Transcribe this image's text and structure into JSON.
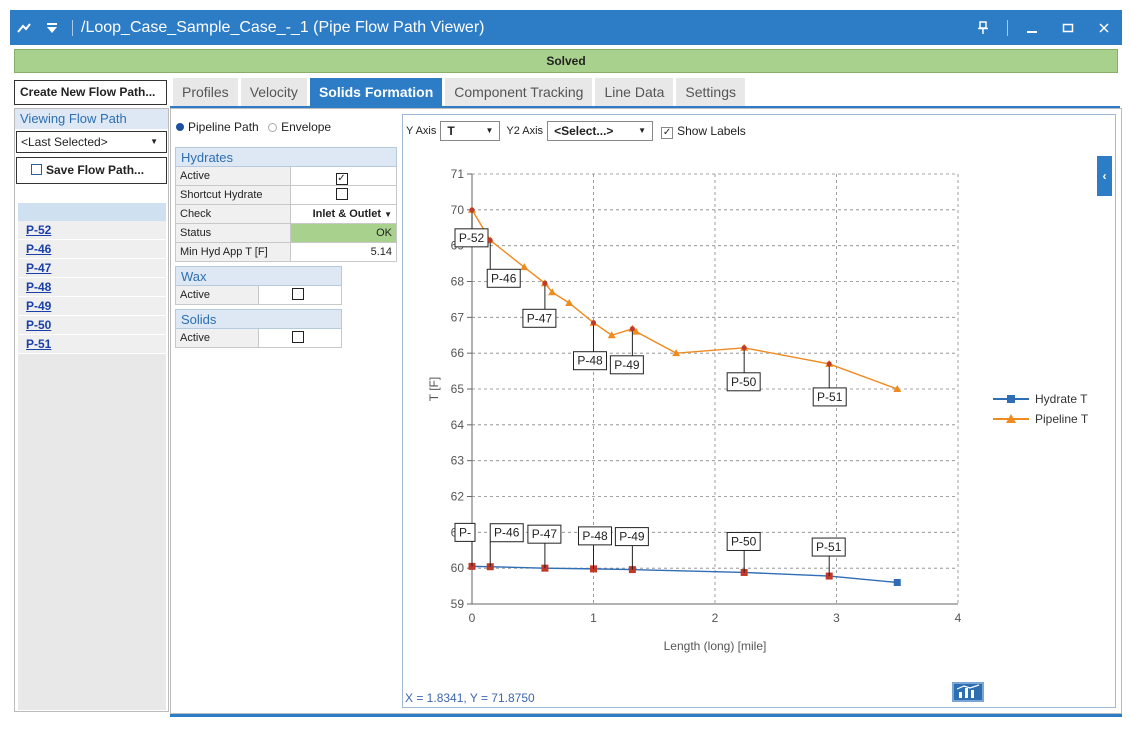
{
  "window": {
    "title": "/Loop_Case_Sample_Case_-_1 (Pipe Flow Path Viewer)",
    "status": "Solved"
  },
  "colors": {
    "accent": "#2d7cc6",
    "status_green": "#a9d18e",
    "hydrate_series": "#2f6db5",
    "pipeline_series": "#ef8a1f",
    "label_marker": "#c0392b"
  },
  "left": {
    "create_label": "Create New Flow Path...",
    "viewing_title": "Viewing Flow Path",
    "selector_value": "<Last Selected>",
    "save_label": "Save Flow Path...",
    "flow_paths": [
      "P-52",
      "P-46",
      "P-47",
      "P-48",
      "P-49",
      "P-50",
      "P-51"
    ]
  },
  "tabs": [
    "Profiles",
    "Velocity",
    "Solids Formation",
    "Component Tracking",
    "Line Data",
    "Settings"
  ],
  "active_tab": "Solids Formation",
  "mode": {
    "pipeline_label": "Pipeline Path",
    "envelope_label": "Envelope",
    "selected": "Pipeline Path"
  },
  "hydrates": {
    "title": "Hydrates",
    "rows": [
      {
        "label": "Active",
        "value": "checked"
      },
      {
        "label": "Shortcut Hydrate",
        "value": "unchecked"
      },
      {
        "label": "Check",
        "value": "Inlet & Outlet"
      },
      {
        "label": "Status",
        "value": "OK"
      },
      {
        "label": "Min Hyd App T [F]",
        "value": "5.14"
      }
    ]
  },
  "wax": {
    "title": "Wax",
    "active_label": "Active",
    "active": false
  },
  "solids": {
    "title": "Solids",
    "active_label": "Active",
    "active": false
  },
  "chart_controls": {
    "y_axis_label": "Y Axis",
    "y_axis_value": "T",
    "y2_axis_label": "Y2 Axis",
    "y2_axis_value": "<Select...>",
    "show_labels_label": "Show Labels",
    "show_labels": true
  },
  "coord_readout": "X = 1.8341, Y = 71.8750",
  "chart_data": {
    "type": "line",
    "xlabel": "Length (long) [mile]",
    "ylabel": "T [F]",
    "xlim": [
      0,
      4
    ],
    "ylim": [
      59,
      71
    ],
    "x_ticks": [
      0,
      1,
      2,
      3,
      4
    ],
    "y_ticks": [
      59,
      60,
      61,
      62,
      63,
      64,
      65,
      66,
      67,
      68,
      69,
      70,
      71
    ],
    "grid": true,
    "legend_position": "right",
    "series": [
      {
        "name": "Hydrate T",
        "marker": "square",
        "x": [
          0,
          0.15,
          0.6,
          1.0,
          1.32,
          2.24,
          2.94,
          3.5
        ],
        "y": [
          60.05,
          60.04,
          60.0,
          59.98,
          59.96,
          59.88,
          59.78,
          59.6
        ]
      },
      {
        "name": "Pipeline T",
        "marker": "triangle",
        "x": [
          0,
          0.15,
          0.43,
          0.6,
          0.66,
          0.8,
          1.0,
          1.15,
          1.32,
          1.35,
          1.68,
          2.24,
          2.94,
          3.5
        ],
        "y": [
          70.0,
          69.15,
          68.4,
          67.95,
          67.7,
          67.4,
          66.85,
          66.5,
          66.68,
          66.6,
          66.0,
          66.15,
          65.7,
          65.0
        ]
      }
    ],
    "pipeline_labels": [
      {
        "text": "P-52",
        "x": 0.0,
        "y": 70.0
      },
      {
        "text": "P-46",
        "x": 0.15,
        "y": 69.15
      },
      {
        "text": "P-47",
        "x": 0.6,
        "y": 67.95
      },
      {
        "text": "P-48",
        "x": 1.0,
        "y": 66.85
      },
      {
        "text": "P-49",
        "x": 1.32,
        "y": 66.68
      },
      {
        "text": "P-50",
        "x": 2.24,
        "y": 66.15
      },
      {
        "text": "P-51",
        "x": 2.94,
        "y": 65.7
      }
    ],
    "hydrate_labels": [
      {
        "text": "P-",
        "x": 0.0,
        "y": 60.05
      },
      {
        "text": "P-46",
        "x": 0.15,
        "y": 60.04
      },
      {
        "text": "P-47",
        "x": 0.6,
        "y": 60.0
      },
      {
        "text": "P-48",
        "x": 1.0,
        "y": 59.98
      },
      {
        "text": "P-49",
        "x": 1.32,
        "y": 59.96
      },
      {
        "text": "P-50",
        "x": 2.24,
        "y": 59.88
      },
      {
        "text": "P-51",
        "x": 2.94,
        "y": 59.78
      }
    ]
  }
}
